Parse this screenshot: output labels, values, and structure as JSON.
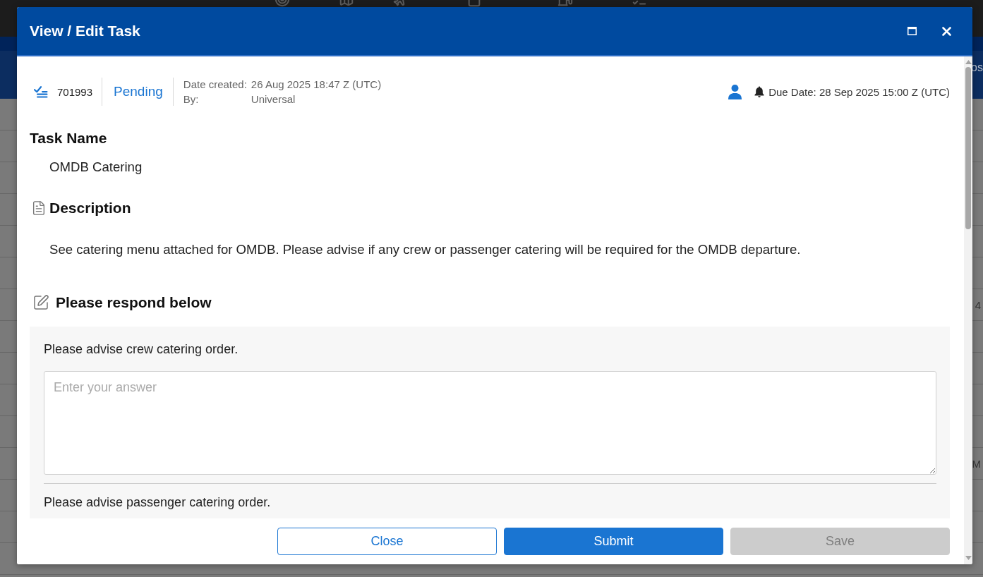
{
  "background_app": {
    "nav_text": "os",
    "table_cells": [
      "4",
      "M"
    ]
  },
  "dialog": {
    "title": "View / Edit Task",
    "task": {
      "id": "701993",
      "status": "Pending",
      "created_label": "Date created:",
      "created_value": "26 Aug 2025 18:47 Z (UTC)",
      "by_label": "By:",
      "by_value": "Universal",
      "due_date": "Due Date: 28 Sep 2025 15:00 Z (UTC)"
    },
    "task_name": {
      "heading": "Task Name",
      "value": "OMDB Catering"
    },
    "description": {
      "heading": "Description",
      "text": "See catering menu attached for OMDB. Please advise if any crew or passenger catering will be required for the OMDB departure."
    },
    "response": {
      "heading": "Please respond below",
      "questions": [
        {
          "label": "Please advise crew catering order.",
          "answer": {
            "placeholder": "Enter your answer"
          }
        },
        {
          "label": "Please advise passenger catering order."
        }
      ]
    },
    "buttons": [
      {
        "label": "Close",
        "kind": "outline",
        "disabled": false
      },
      {
        "label": "Submit",
        "kind": "filled",
        "disabled": false
      },
      {
        "label": "Save",
        "kind": "filled",
        "disabled": true
      }
    ]
  }
}
